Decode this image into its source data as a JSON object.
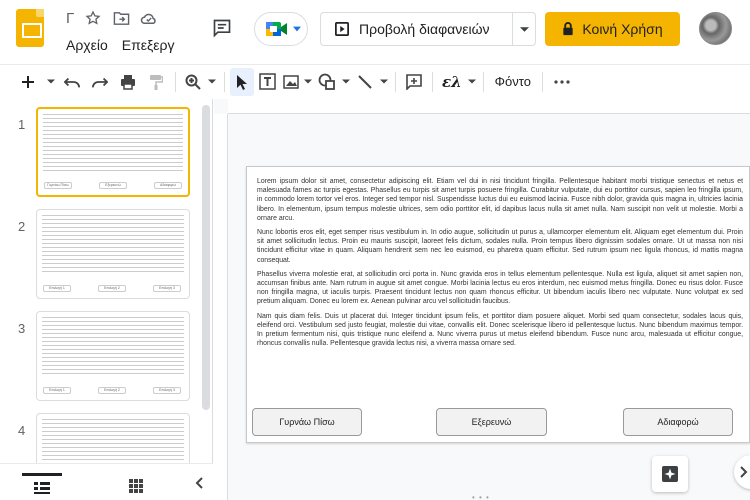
{
  "app": {
    "title_char": "Γ",
    "menu": [
      "Αρχείο",
      "Επεξεργ"
    ]
  },
  "header": {
    "present_label": "Προβολή διαφανειών",
    "share_label": "Κοινή Χρήση"
  },
  "toolbar": {
    "lambda_label": "ελ",
    "background_label": "Φόντο"
  },
  "filmstrip": {
    "slides": [
      {
        "number": "1",
        "buttons": [
          "Γυρνάω Πίσω",
          "Εξερευνώ",
          "Αδιαφορώ"
        ]
      },
      {
        "number": "2",
        "buttons": [
          "Επιλογή 1",
          "Επιλογή 2",
          "Επιλογή 3"
        ]
      },
      {
        "number": "3",
        "buttons": [
          "Επιλογή 1",
          "Επιλογή 2",
          "Επιλογή 3"
        ]
      },
      {
        "number": "4",
        "buttons": []
      }
    ]
  },
  "slide": {
    "paragraphs": [
      "Lorem ipsum dolor sit amet, consectetur adipiscing elit. Etiam vel dui in nisi tincidunt fringilla. Pellentesque habitant morbi tristique senectus et netus et malesuada fames ac turpis egestas. Phasellus eu turpis sit amet turpis posuere fringilla. Curabitur vulputate, dui eu porttitor cursus, sapien leo fringilla ipsum, in commodo lorem tortor vel eros. Integer sed tempor nisl. Suspendisse luctus dui eu euismod lacinia. Fusce nibh dolor, gravida quis magna in, ultricies lacinia libero. In elementum, ipsum tempus molestie ultrices, sem odio porttitor elit, id dapibus lacus nulla sit amet nulla. Nam suscipit non velit ut molestie. Morbi a ornare arcu.",
      "Nunc lobortis eros elit, eget semper risus vestibulum in. In odio augue, sollicitudin ut purus a, ullamcorper elementum elit. Aliquam eget elementum dui. Proin sit amet sollicitudin lectus. Proin eu mauris suscipit, laoreet felis dictum, sodales nulla. Proin tempus libero dignissim sodales ornare. Ut ut massa non nisi tincidunt efficitur vitae in quam. Aliquam hendrerit sem nec leo euismod, eu pharetra quam efficitur. Sed rutrum ipsum nec ligula rhoncus, id mattis magna consequat.",
      "Phasellus viverra molestie erat, at sollicitudin orci porta in. Nunc gravida eros in tellus elementum pellentesque. Nulla est ligula, aliquet sit amet sapien non, accumsan finibus ante. Nam rutrum in augue sit amet congue. Morbi lacinia lectus eu eros interdum, nec euismod metus fringilla. Donec eu risus dolor. Fusce non fringilla magna, ut iaculis turpis. Praesent tincidunt lectus non quam rhoncus efficitur. Ut bibendum iaculis libero nec vulputate. Nunc volutpat ex sed pretium aliquam. Donec eu lorem ex. Aenean pulvinar arcu vel sollicitudin faucibus.",
      "Nam quis diam felis. Duis ut placerat dui. Integer tincidunt ipsum felis, et porttitor diam posuere aliquet. Morbi sed quam consectetur, sodales lacus quis, eleifend orci. Vestibulum sed justo feugiat, molestie dui vitae, convallis elit. Donec scelerisque libero id pellentesque luctus. Nunc bibendum maximus tempor. In pretium fermentum nisi, quis tristique nunc eleifend a. Nunc viverra purus ut metus eleifend bibendum. Fusce nunc arcu, malesuada ut efficitur congue, rhoncus convallis nulla. Pellentesque gravida lectus nisi, a viverra massa ornare sed."
    ],
    "buttons": {
      "back": "Γυρνάω Πίσω",
      "explore": "Εξερευνώ",
      "ignore": "Αδιαφορώ"
    }
  },
  "colors": {
    "accent": "#f4b400",
    "selected_tool_bg": "#e8f0fe"
  }
}
